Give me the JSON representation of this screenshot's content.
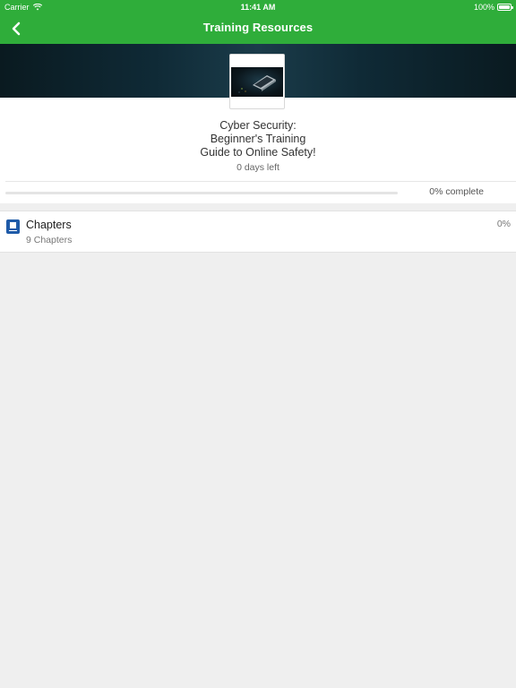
{
  "status_bar": {
    "carrier": "Carrier",
    "time": "11:41 AM",
    "battery": "100%",
    "battery_level": 1.0
  },
  "nav": {
    "title": "Training Resources",
    "back_icon": "chevron-left-icon"
  },
  "course": {
    "title": "Cyber Security:\nBeginner's Training\nGuide to Online Safety!",
    "days_left": "0 days left",
    "progress_label": "0% complete",
    "progress_fraction": 0
  },
  "chapters": {
    "label": "Chapters",
    "count_label": "9 Chapters",
    "percent": "0%",
    "icon": "book-icon"
  },
  "colors": {
    "brand_green": "#2fad3a",
    "icon_blue": "#1e5aa8",
    "background": "#efefef"
  }
}
